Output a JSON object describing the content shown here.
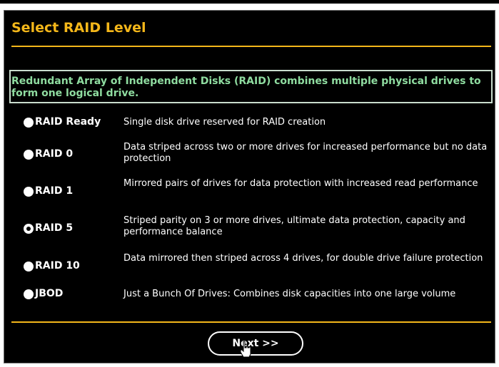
{
  "page": {
    "title": "Select RAID Level",
    "info": "Redundant Array of Independent Disks (RAID) combines multiple physical drives to form one logical drive.",
    "next_label": "Next >>"
  },
  "options": [
    {
      "label": "RAID Ready",
      "desc": "Single disk drive reserved for RAID creation",
      "selected": false
    },
    {
      "label": "RAID 0",
      "desc": "Data striped across two or more drives for increased performance but no data protection",
      "selected": false
    },
    {
      "label": "RAID 1",
      "desc": "Mirrored pairs of drives for data protection with increased read performance",
      "selected": false
    },
    {
      "label": "RAID 5",
      "desc": "Striped parity on 3 or more drives, ultimate data protection, capacity and performance balance",
      "selected": true
    },
    {
      "label": "RAID 10",
      "desc": "Data mirrored then striped across 4 drives, for double drive failure protection",
      "selected": false
    },
    {
      "label": "JBOD",
      "desc": "Just a Bunch Of Drives: Combines disk capacities into one large volume",
      "selected": false
    }
  ],
  "colors": {
    "title": "#f4b71a",
    "info_text": "#8fdca0",
    "background": "#000000"
  },
  "icons": {
    "cursor": "hand-pointer-icon"
  }
}
